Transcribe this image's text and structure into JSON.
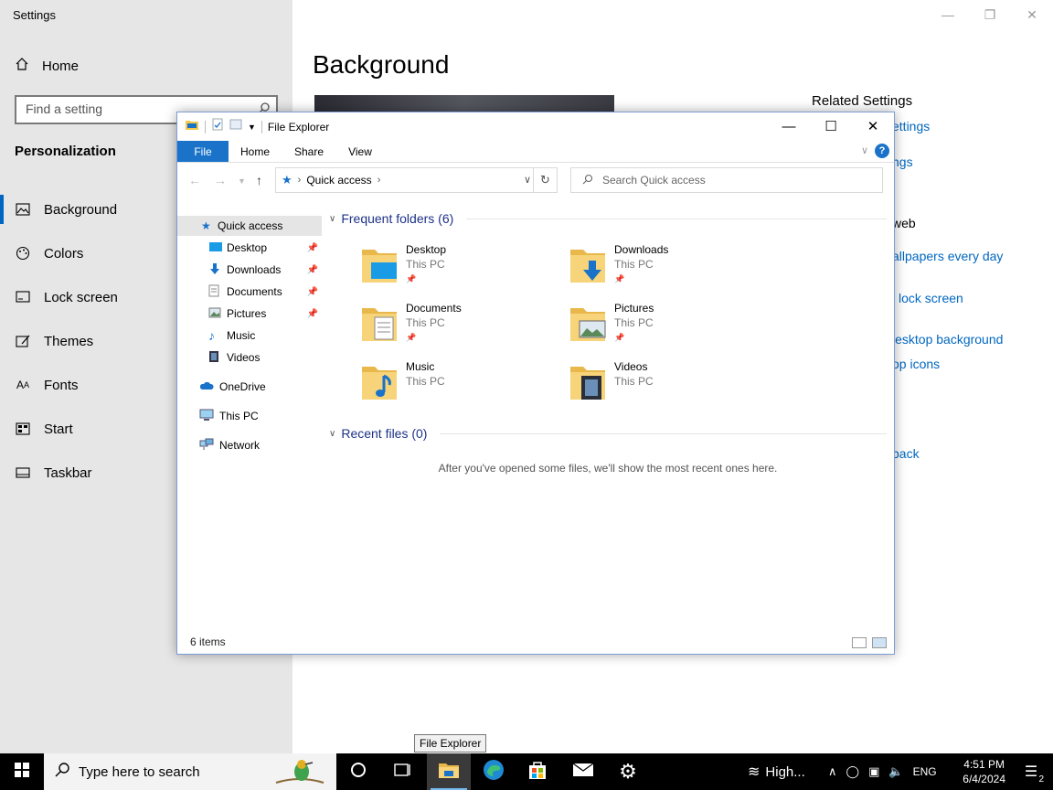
{
  "settings": {
    "title": "Settings",
    "home_label": "Home",
    "search_placeholder": "Find a setting",
    "section_title": "Personalization",
    "nav": [
      {
        "label": "Background",
        "icon": "picture-icon",
        "active": true
      },
      {
        "label": "Colors",
        "icon": "palette-icon"
      },
      {
        "label": "Lock screen",
        "icon": "lock-screen-icon"
      },
      {
        "label": "Themes",
        "icon": "themes-icon"
      },
      {
        "label": "Fonts",
        "icon": "fonts-icon"
      },
      {
        "label": "Start",
        "icon": "start-icon"
      },
      {
        "label": "Taskbar",
        "icon": "taskbar-icon"
      }
    ],
    "page_title": "Background",
    "related_title": "Related Settings",
    "related_links": [
      "ettings",
      "ngs",
      "web",
      "allpapers every day",
      "lock screen",
      "lesktop background",
      "op icons",
      "back"
    ]
  },
  "explorer": {
    "title": "File Explorer",
    "ribbon_tabs": [
      "File",
      "Home",
      "Share",
      "View"
    ],
    "address": "Quick access",
    "search_placeholder": "Search Quick access",
    "nav_items": [
      {
        "label": "Quick access",
        "icon": "quick-access-star-icon",
        "selected": true
      },
      {
        "label": "Desktop",
        "icon": "desktop-icon",
        "pinned": true
      },
      {
        "label": "Downloads",
        "icon": "downloads-icon",
        "pinned": true
      },
      {
        "label": "Documents",
        "icon": "documents-icon",
        "pinned": true
      },
      {
        "label": "Pictures",
        "icon": "pictures-icon",
        "pinned": true
      },
      {
        "label": "Music",
        "icon": "music-icon"
      },
      {
        "label": "Videos",
        "icon": "videos-icon"
      },
      {
        "label": "OneDrive",
        "icon": "onedrive-icon"
      },
      {
        "label": "This PC",
        "icon": "this-pc-icon"
      },
      {
        "label": "Network",
        "icon": "network-icon"
      }
    ],
    "frequent_header": "Frequent folders (6)",
    "folders": [
      {
        "name": "Desktop",
        "location": "This PC",
        "pinned": true
      },
      {
        "name": "Downloads",
        "location": "This PC",
        "pinned": true
      },
      {
        "name": "Documents",
        "location": "This PC",
        "pinned": true
      },
      {
        "name": "Pictures",
        "location": "This PC",
        "pinned": true
      },
      {
        "name": "Music",
        "location": "This PC"
      },
      {
        "name": "Videos",
        "location": "This PC"
      }
    ],
    "recent_header": "Recent files (0)",
    "recent_empty": "After you've opened some files, we'll show the most recent ones here.",
    "status": "6 items"
  },
  "tooltip": "File Explorer",
  "taskbar": {
    "search_placeholder": "Type here to search",
    "weather": "High...",
    "language": "ENG",
    "time": "4:51 PM",
    "date": "6/4/2024",
    "notification_count": "2"
  }
}
